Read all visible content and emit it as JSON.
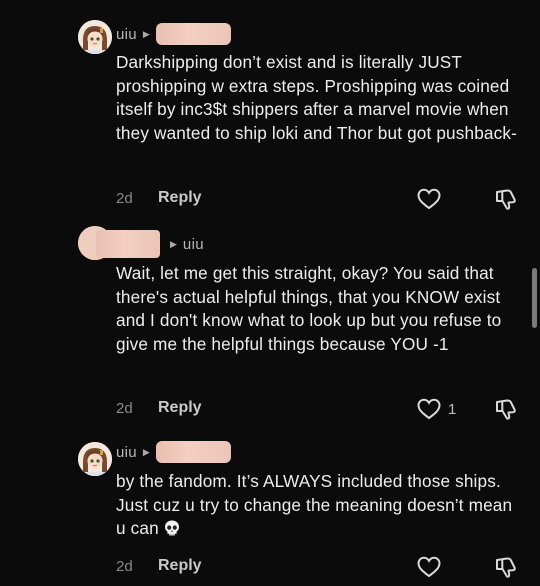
{
  "comments": [
    {
      "username": "uiu",
      "body": "Darkshipping don’t exist and is literally JUST proshipping w extra steps. Proshipping was coined itself by inc3$t shippers after a marvel movie when they wanted to ship loki and Thor but got pushback-",
      "time": "2d",
      "reply_label": "Reply",
      "likes": ""
    },
    {
      "username": "uiu",
      "body": "Wait, let me get this straight, okay? You said that there's actual helpful things, that you KNOW exist and I don't know what to look up but you refuse to give me the helpful things because YOU -1",
      "time": "2d",
      "reply_label": "Reply",
      "likes": "1"
    },
    {
      "username": "uiu",
      "body": "by the fandom. It’s ALWAYS included those ships. Just cuz u try to change the meaning doesn’t mean u can",
      "emoji": "skull-emoji",
      "time": "2d",
      "reply_label": "Reply",
      "likes": ""
    }
  ],
  "icons": {
    "like": "heart-outline-icon",
    "dislike": "thumbs-down-icon",
    "reply_arrow": "triangle-right-icon"
  },
  "colors": {
    "background": "#0b0b0b",
    "redaction": "#f0c8bb"
  }
}
